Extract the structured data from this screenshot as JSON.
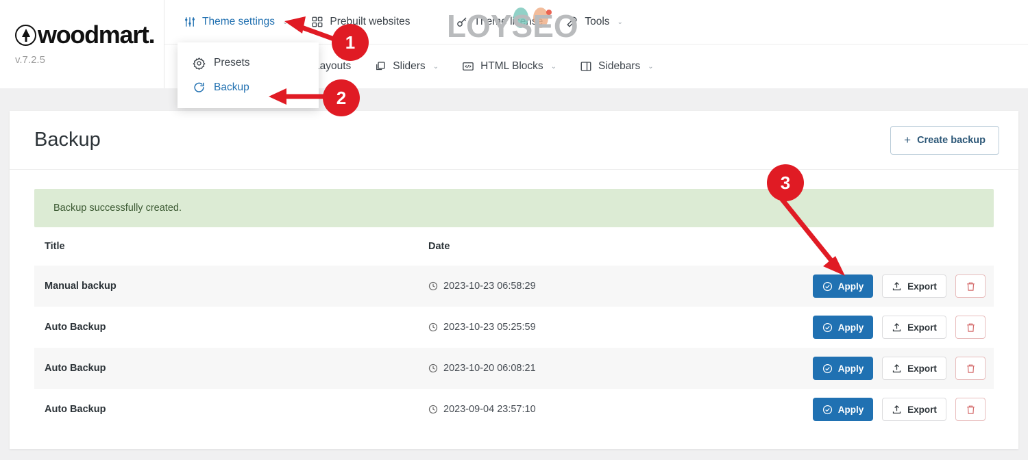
{
  "brand": {
    "name": "woodmart.",
    "version": "v.7.2.5",
    "logo_icon": "woodmart-tree-circle-icon"
  },
  "nav": {
    "row1": [
      {
        "label": "Theme settings",
        "icon": "sliders-icon",
        "active": true,
        "caret": "⌄"
      },
      {
        "label": "Prebuilt websites",
        "icon": "grid-2x2-icon",
        "active": false,
        "caret": ""
      },
      {
        "label": "Theme license",
        "icon": "key-icon",
        "active": false,
        "caret": ""
      },
      {
        "label": "Tools",
        "icon": "wrench-icon",
        "active": false,
        "caret": "⌄"
      }
    ],
    "row2": [
      {
        "label": "Layouts",
        "icon": "",
        "active": false,
        "caret": ""
      },
      {
        "label": "Sliders",
        "icon": "layers-icon",
        "active": false,
        "caret": "⌄"
      },
      {
        "label": "HTML Blocks",
        "icon": "code-icon",
        "active": false,
        "caret": "⌄"
      },
      {
        "label": "Sidebars",
        "icon": "sidebar-icon",
        "active": false,
        "caret": "⌄"
      }
    ]
  },
  "dropdown": {
    "items": [
      {
        "label": "Presets",
        "icon": "gear-icon",
        "active": false
      },
      {
        "label": "Backup",
        "icon": "refresh-icon",
        "active": true
      }
    ]
  },
  "watermark": {
    "text": "LOYSEO"
  },
  "page": {
    "title": "Backup",
    "create_button": {
      "label": "Create backup",
      "icon": "plus-icon"
    },
    "notice": {
      "text": "Backup successfully created."
    }
  },
  "table": {
    "headers": {
      "title": "Title",
      "date": "Date"
    },
    "rows": [
      {
        "title": "Manual backup",
        "date": "2023-10-23 06:58:29",
        "striped": true
      },
      {
        "title": "Auto Backup",
        "date": "2023-10-23 05:25:59",
        "striped": false
      },
      {
        "title": "Auto Backup",
        "date": "2023-10-20 06:08:21",
        "striped": true
      },
      {
        "title": "Auto Backup",
        "date": "2023-09-04 23:57:10",
        "striped": false
      }
    ],
    "actions": {
      "apply_label": "Apply",
      "apply_icon": "check-circle-icon",
      "export_label": "Export",
      "export_icon": "upload-icon",
      "delete_icon": "trash-icon",
      "date_icon": "clock-icon"
    }
  },
  "annotations": [
    {
      "number": "1",
      "points_to": "Theme settings"
    },
    {
      "number": "2",
      "points_to": "Backup"
    },
    {
      "number": "3",
      "points_to": "Apply"
    }
  ],
  "colors": {
    "accent_blue": "#2271b1",
    "apply_blue": "#2071b2",
    "notice_green_bg": "#dcebd4",
    "notice_green_text": "#3c5a33",
    "annotation_red": "#e01b24",
    "page_bg": "#f0f0f1"
  }
}
